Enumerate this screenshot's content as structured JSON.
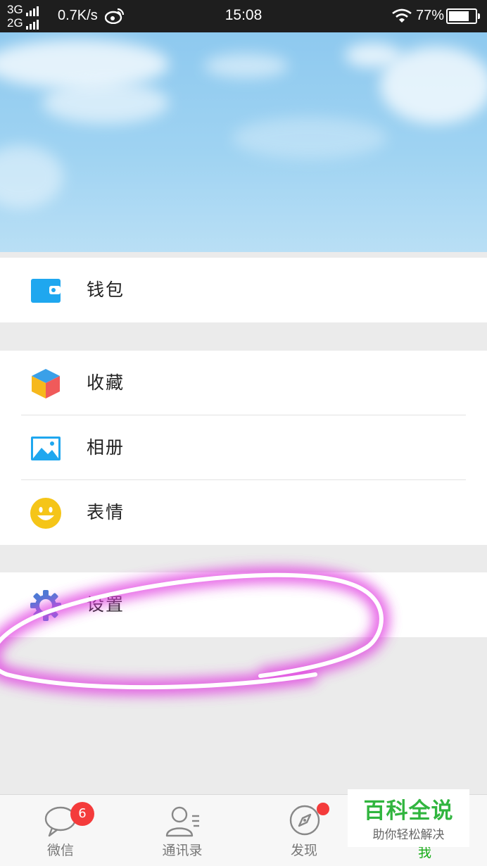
{
  "status_bar": {
    "net_1": "3G",
    "net_2": "2G",
    "speed": "0.7K/s",
    "time": "15:08",
    "battery": "77%",
    "battery_level": 0.77
  },
  "menu": {
    "wallet": {
      "label": "钱包",
      "icon": "wallet-icon",
      "color": "#1fa7ef"
    },
    "favorites": {
      "label": "收藏",
      "icon": "cube-icon"
    },
    "album": {
      "label": "相册",
      "icon": "picture-icon",
      "color": "#1fa7ef"
    },
    "stickers": {
      "label": "表情",
      "icon": "smiley-icon",
      "color": "#f5c518"
    },
    "settings": {
      "label": "设置",
      "icon": "gear-icon",
      "color": "#4a7bd4"
    }
  },
  "tabs": {
    "chats": {
      "label": "微信",
      "badge": "6"
    },
    "contacts": {
      "label": "通讯录"
    },
    "discover": {
      "label": "发现"
    },
    "me": {
      "label": "我"
    }
  },
  "watermark": {
    "title": "百科全说",
    "subtitle": "助你轻松解决"
  },
  "colors": {
    "accent_green": "#1aad19",
    "badge_red": "#f43b3b",
    "highlight": "#e040e0"
  }
}
